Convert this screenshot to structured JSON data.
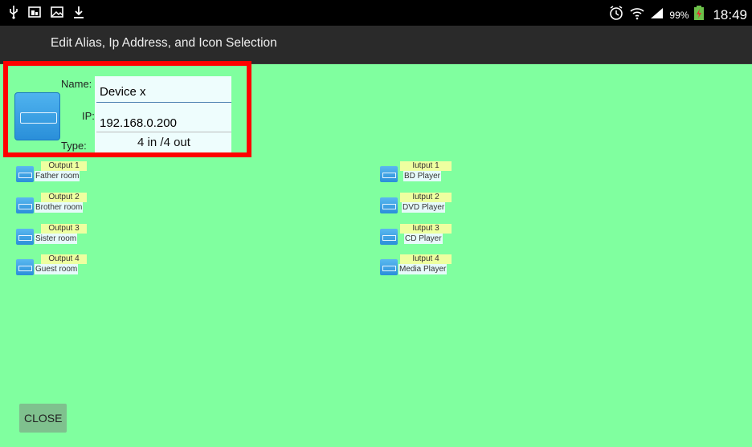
{
  "status_bar": {
    "left_icons": [
      "usb-icon",
      "gallery-icon",
      "image-icon",
      "download-icon"
    ],
    "battery": "99%",
    "time": "18:49"
  },
  "title_bar": {
    "title": "Edit Alias, Ip Address, and Icon Selection"
  },
  "device": {
    "name_label": "Name:",
    "name_value": "Device x",
    "ip_label": "IP:",
    "ip_value": "192.168.0.200",
    "type_label": "Type:",
    "type_value": "4 in /4 out"
  },
  "outputs": [
    {
      "name": "Output 1",
      "alias": "Father room"
    },
    {
      "name": "Output 2",
      "alias": "Brother room"
    },
    {
      "name": "Output 3",
      "alias": "Sister room"
    },
    {
      "name": "Output 4",
      "alias": "Guest room"
    }
  ],
  "inputs": [
    {
      "name": "Iutput 1",
      "alias": "BD Player"
    },
    {
      "name": "Iutput 2",
      "alias": "DVD Player"
    },
    {
      "name": "Iutput 3",
      "alias": "CD Player"
    },
    {
      "name": "Iutput 4",
      "alias": "Media Player"
    }
  ],
  "close_label": "CLOSE",
  "colors": {
    "background": "#80ff9f",
    "highlight": "#ff0000",
    "titlebar": "#2a2a2a"
  }
}
